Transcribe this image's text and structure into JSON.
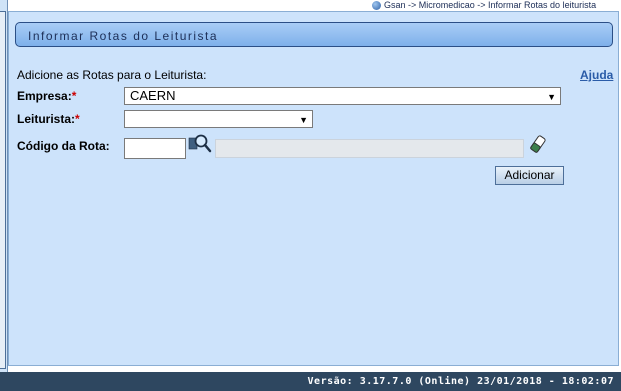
{
  "breadcrumb": "Gsan -> Micromedicao -> Informar Rotas do leiturista",
  "title": "Informar Rotas do Leiturista",
  "instructions": "Adicione as Rotas para o Leiturista:",
  "help_label": "Ajuda",
  "fields": {
    "empresa": {
      "label": "Empresa:",
      "required_mark": "*",
      "selected": "CAERN"
    },
    "leiturista": {
      "label": "Leiturista:",
      "required_mark": "*",
      "selected": ""
    },
    "codigo_rota": {
      "label": "Código da Rota:",
      "value": ""
    }
  },
  "add_button": "Adicionar",
  "footer": "Versão: 3.17.7.0 (Online) 23/01/2018 - 18:02:07",
  "icons": {
    "search": "magnifier-icon",
    "clear": "eraser-icon",
    "breadcrumb": "globe-icon"
  }
}
